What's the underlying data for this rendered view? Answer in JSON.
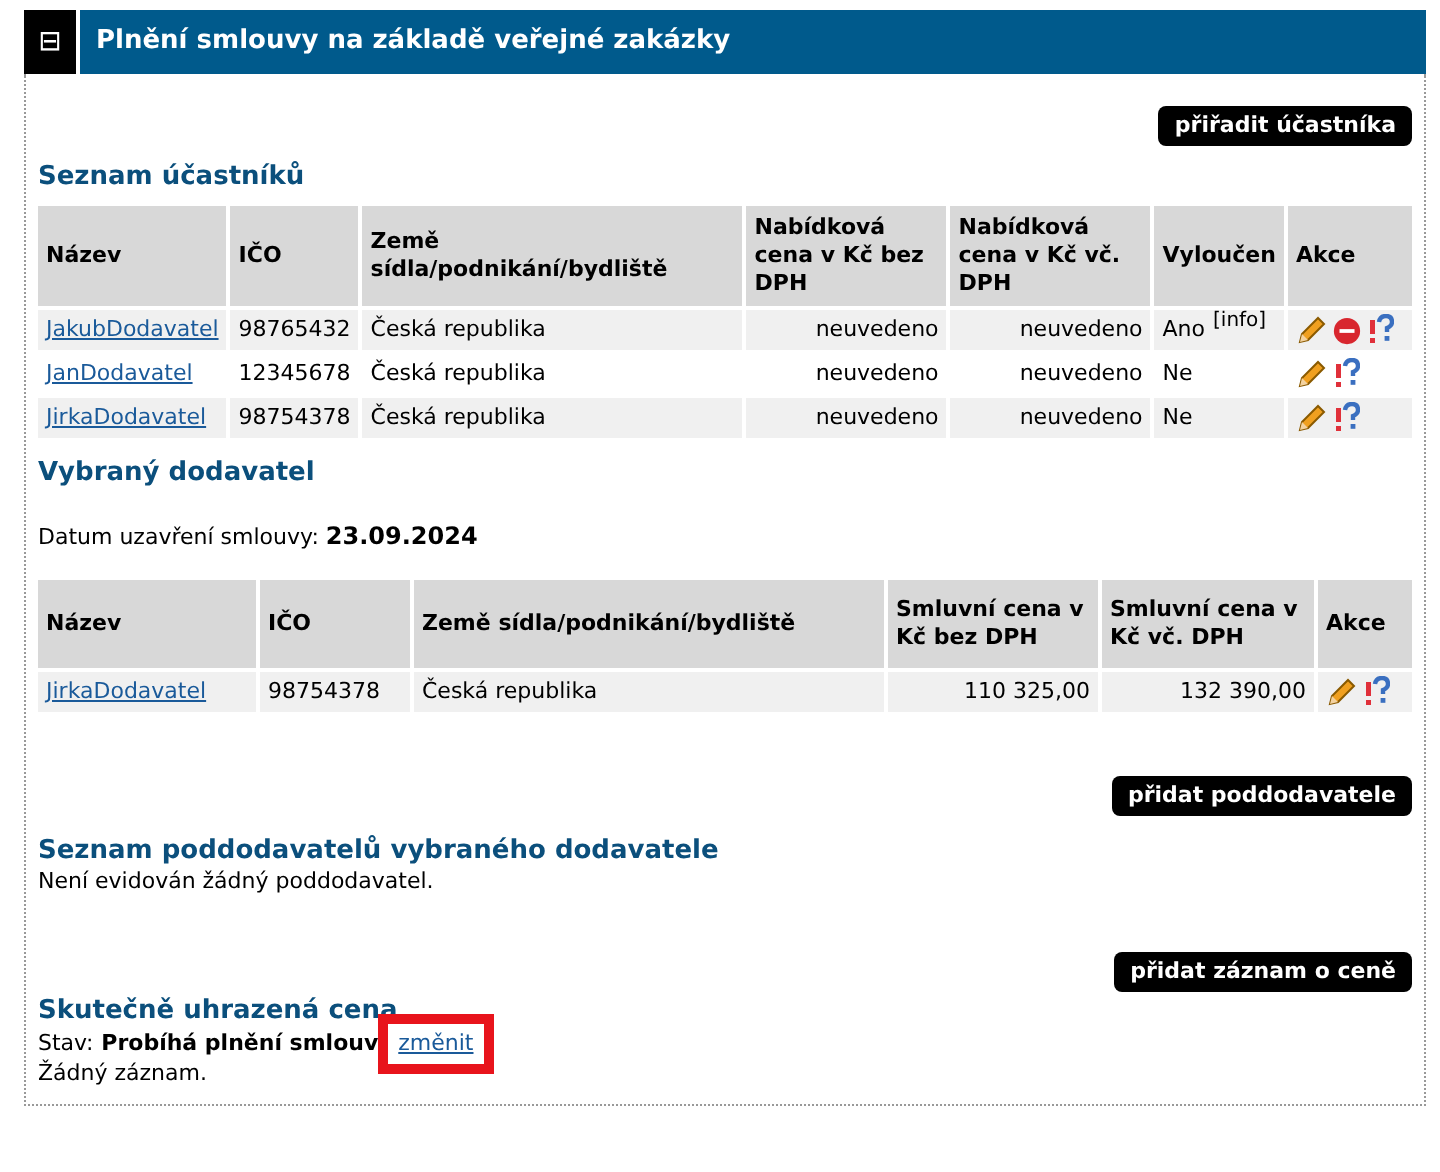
{
  "panel": {
    "toggle": "⊟",
    "title": "Plnění smlouvy na základě veřejné zakázky"
  },
  "assign_button": "přiřadit účastníka",
  "participants": {
    "heading": "Seznam účastníků",
    "columns": [
      "Název",
      "IČO",
      "Země sídla/podnikání/bydliště",
      "Nabídková cena v Kč bez DPH",
      "Nabídková cena v Kč vč. DPH",
      "Vyloučen",
      "Akce"
    ],
    "rows": [
      {
        "name": "JakubDodavatel",
        "ico": "98765432",
        "country": "Česká republika",
        "price_net": "neuvedeno",
        "price_gross": "neuvedeno",
        "excluded": "Ano",
        "info": "[info]",
        "actions": [
          {
            "kind": "edit"
          },
          {
            "kind": "remove"
          },
          {
            "kind": "help"
          }
        ]
      },
      {
        "name": "JanDodavatel",
        "ico": "12345678",
        "country": "Česká republika",
        "price_net": "neuvedeno",
        "price_gross": "neuvedeno",
        "excluded": "Ne",
        "actions": [
          {
            "kind": "edit"
          },
          {
            "kind": "help"
          }
        ]
      },
      {
        "name": "JirkaDodavatel",
        "ico": "98754378",
        "country": "Česká republika",
        "price_net": "neuvedeno",
        "price_gross": "neuvedeno",
        "excluded": "Ne",
        "actions": [
          {
            "kind": "edit"
          },
          {
            "kind": "help"
          }
        ]
      }
    ]
  },
  "selected": {
    "heading": "Vybraný dodavatel",
    "date_label": "Datum uzavření smlouvy:",
    "date": "23.09.2024",
    "columns": [
      "Název",
      "IČO",
      "Země sídla/podnikání/bydliště",
      "Smluvní cena v Kč bez DPH",
      "Smluvní cena v Kč vč. DPH",
      "Akce"
    ],
    "rows": [
      {
        "name": "JirkaDodavatel",
        "ico": "98754378",
        "country": "Česká republika",
        "price_net": "110 325,00",
        "price_gross": "132 390,00",
        "actions": [
          {
            "kind": "edit"
          },
          {
            "kind": "help"
          }
        ]
      }
    ]
  },
  "subcontractor_button": "přidat poddodavatele",
  "subcontractors": {
    "heading": "Seznam poddodavatelů vybraného dodavatele",
    "empty": "Není evidován žádný poddodavatel."
  },
  "price_button": "přidat záznam o ceně",
  "paid": {
    "heading": "Skutečně uhrazená cena",
    "status_label": "Stav:",
    "status": "Probíhá plnění smlouv",
    "change_link": "změnit",
    "highlighted": true,
    "empty": "Žádný záznam."
  }
}
